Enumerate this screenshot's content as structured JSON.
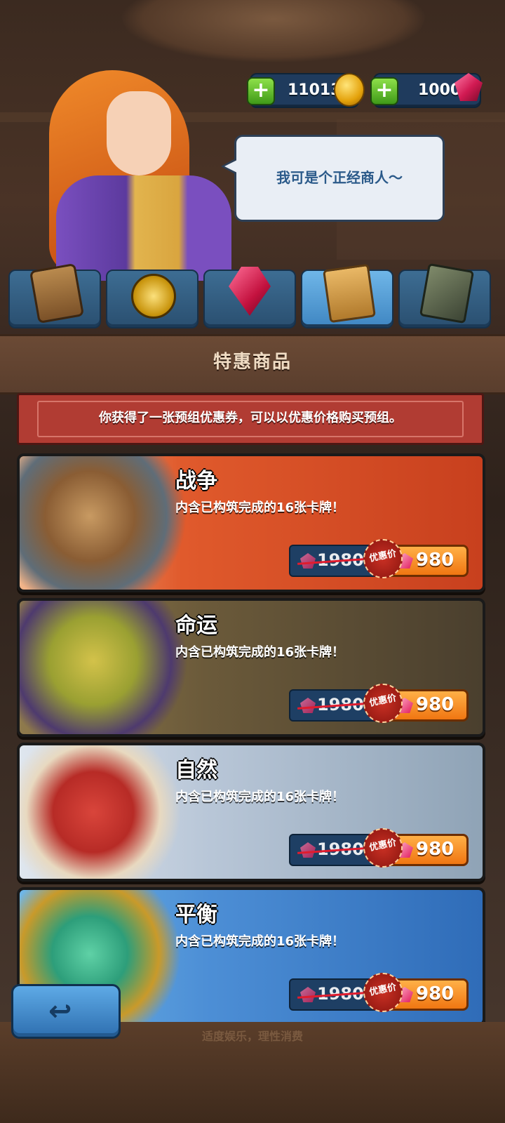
{
  "currency": {
    "coins": "11013",
    "gems": "1000",
    "coin_icon": "gold-coin-icon",
    "gem_icon": "ruby-gem-icon",
    "add_icon": "plus-icon"
  },
  "merchant": {
    "speech": "我可是个正经商人～"
  },
  "tabs": [
    {
      "icon": "card-pack-icon",
      "active": false
    },
    {
      "icon": "gold-watch-icon",
      "active": false
    },
    {
      "icon": "ruby-gem-icon",
      "active": false
    },
    {
      "icon": "deck-book-icon",
      "active": true
    },
    {
      "icon": "lightning-card-icon",
      "active": false
    }
  ],
  "section": {
    "title": "特惠商品"
  },
  "notice": {
    "text": "你获得了一张预组优惠券，可以以优惠价格购买预组。"
  },
  "decks": [
    {
      "name": "战争",
      "desc": "内含已构筑完成的16张卡牌！",
      "old_price": "1980",
      "badge": "优惠价",
      "price": "980",
      "accent": "#d9522b"
    },
    {
      "name": "命运",
      "desc": "内含已构筑完成的16张卡牌！",
      "old_price": "1980",
      "badge": "优惠价",
      "price": "980",
      "accent": "#6b5a3a"
    },
    {
      "name": "自然",
      "desc": "内含已构筑完成的16张卡牌！",
      "old_price": "1980",
      "badge": "优惠价",
      "price": "980",
      "accent": "#b9c7d8"
    },
    {
      "name": "平衡",
      "desc": "内含已构筑完成的16张卡牌！",
      "old_price": "1980",
      "badge": "优惠价",
      "price": "980",
      "accent": "#4d8fd6"
    }
  ],
  "footer": {
    "back_icon": "back-arrow-icon",
    "text": "适度娱乐，理性消费"
  }
}
